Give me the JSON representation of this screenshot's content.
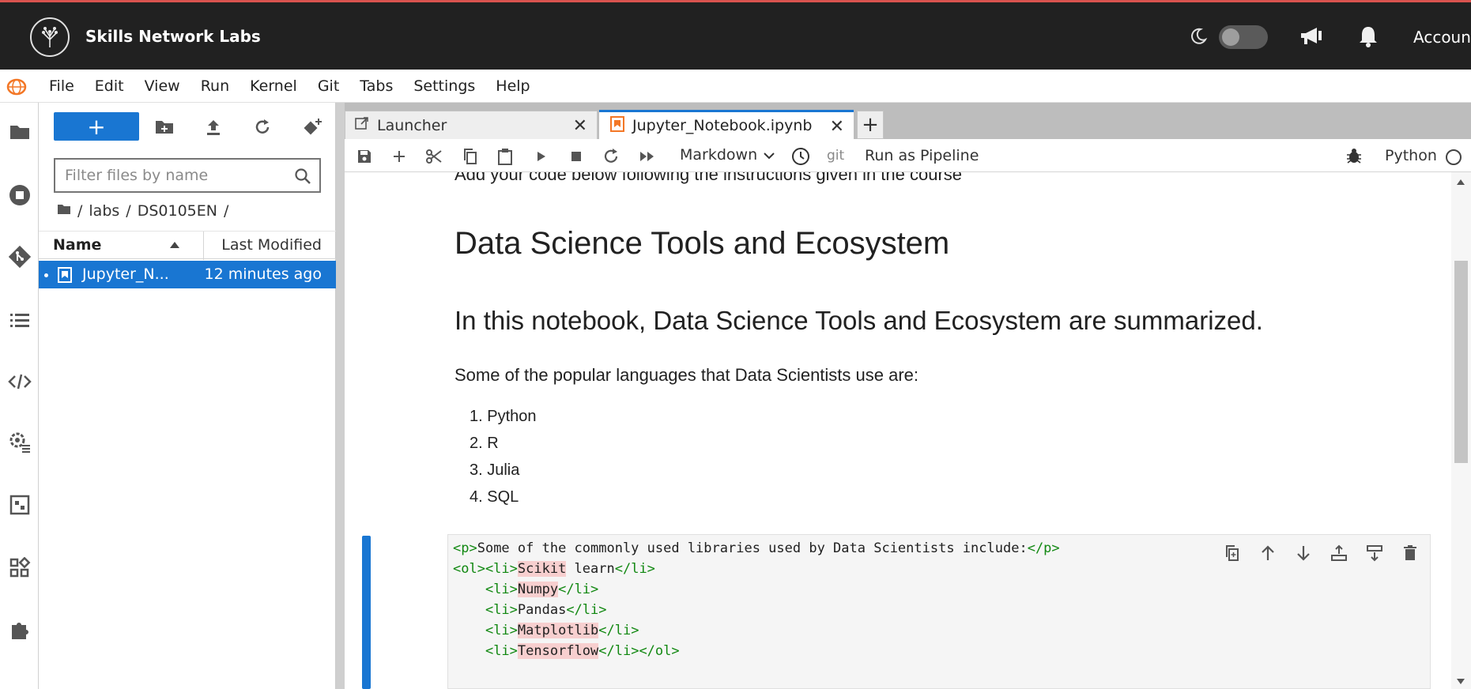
{
  "header": {
    "brand": "Skills Network Labs",
    "account": "Account"
  },
  "menu": {
    "items": [
      "File",
      "Edit",
      "View",
      "Run",
      "Kernel",
      "Git",
      "Tabs",
      "Settings",
      "Help"
    ]
  },
  "file_browser": {
    "new_label": "+",
    "filter_placeholder": "Filter files by name",
    "breadcrumb": [
      "/",
      "labs",
      "/",
      "DS0105EN",
      "/"
    ],
    "columns": {
      "name": "Name",
      "modified": "Last Modified"
    },
    "files": [
      {
        "name": "Jupyter_N...",
        "modified": "12 minutes ago"
      }
    ]
  },
  "tabs": [
    {
      "label": "Launcher"
    },
    {
      "label": "Jupyter_Notebook.ipynb"
    }
  ],
  "toolbar": {
    "cell_type": "Markdown",
    "git": "git",
    "pipeline": "Run as Pipeline",
    "kernel": "Python"
  },
  "notebook": {
    "cut_line": "Add your code below following the instructions given in the course",
    "h1": "Data Science Tools and Ecosystem",
    "h2": "In this notebook, Data Science Tools and Ecosystem are summarized.",
    "paragraph": "Some of the popular languages that Data Scientists use are:",
    "languages": [
      "1. Python",
      "2. R",
      "3. Julia",
      "4. SQL"
    ],
    "code": {
      "line1_open": "<p>",
      "line1_text": "Some of the commonly used libraries used by Data Scientists include:",
      "line1_close": "</p>",
      "line2_open": "<ol><li>",
      "line2_word": "Scikit",
      "line2_rest": " learn",
      "line2_close": "</li>",
      "indent": "    ",
      "li_open": "<li>",
      "li_close": "</li>",
      "li_close_ol": "</li></ol>",
      "line3_word": "Numpy",
      "line4_word": "Pandas",
      "line5_word": "Matplotlib",
      "line6_word": "Tensorflow"
    }
  },
  "colors": {
    "accent": "#1976d2",
    "header_bg": "#212121",
    "tag_green": "#118811",
    "spell_highlight": "#f7cfcf"
  }
}
